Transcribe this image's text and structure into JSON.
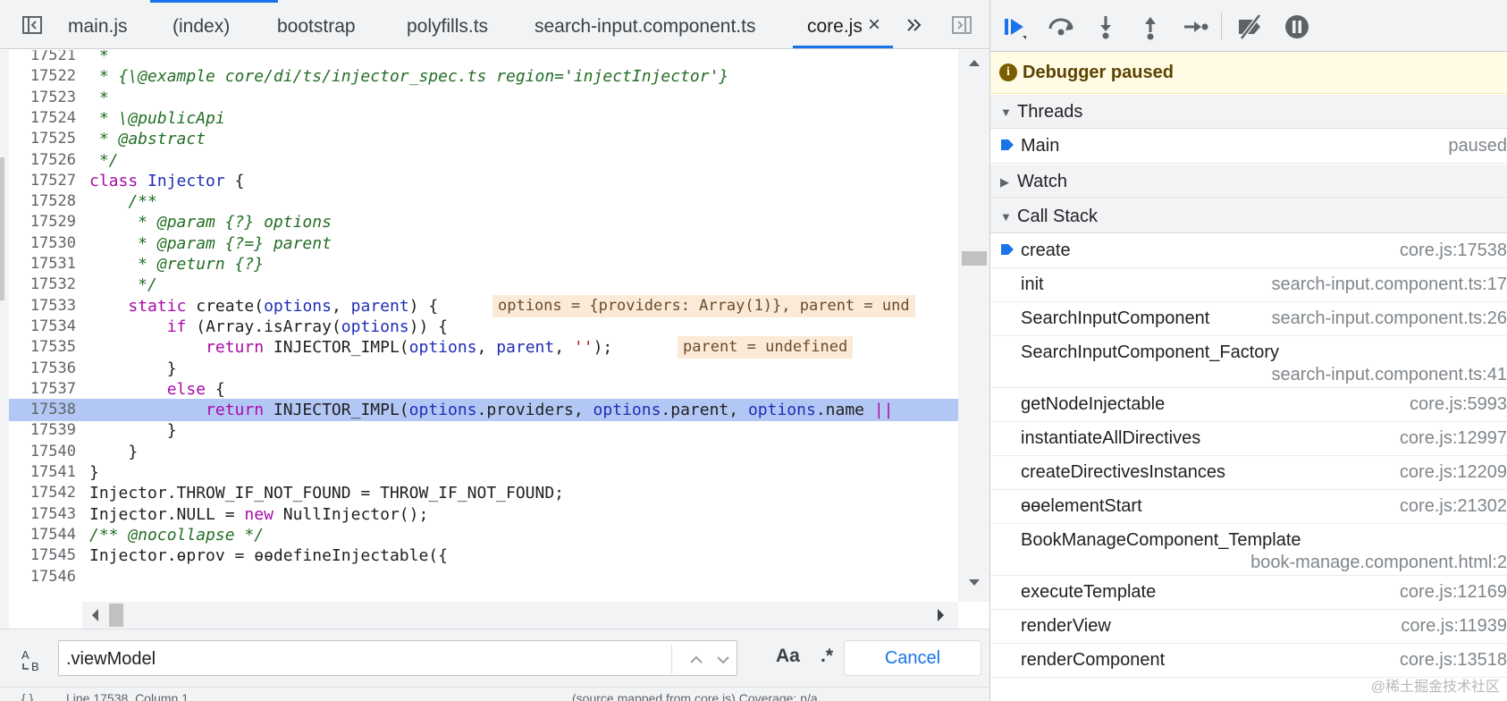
{
  "tabs": [
    {
      "label": "main.js"
    },
    {
      "label": "(index)"
    },
    {
      "label": "bootstrap"
    },
    {
      "label": "polyfills.ts"
    },
    {
      "label": "search-input.component.ts"
    },
    {
      "label": "core.js",
      "active": true
    }
  ],
  "code_lines": [
    {
      "n": "17521",
      "segments": [
        {
          "t": " *",
          "c": "c-cm"
        }
      ]
    },
    {
      "n": "17522",
      "segments": [
        {
          "t": " * {\\@example core/di/ts/injector_spec.ts region='injectInjector'}",
          "c": "c-cm"
        }
      ]
    },
    {
      "n": "17523",
      "segments": [
        {
          "t": " *",
          "c": "c-cm"
        }
      ]
    },
    {
      "n": "17524",
      "segments": [
        {
          "t": " * \\@publicApi",
          "c": "c-cm"
        }
      ]
    },
    {
      "n": "17525",
      "segments": [
        {
          "t": " * @abstract",
          "c": "c-cm"
        }
      ]
    },
    {
      "n": "17526",
      "segments": [
        {
          "t": " */",
          "c": "c-cm"
        }
      ]
    },
    {
      "n": "17527",
      "segments": [
        {
          "t": "class ",
          "c": "c-kw"
        },
        {
          "t": "Injector",
          "c": "c-id"
        },
        {
          "t": " {",
          "c": ""
        }
      ]
    },
    {
      "n": "17528",
      "segments": [
        {
          "t": "    /**",
          "c": "c-cm"
        }
      ]
    },
    {
      "n": "17529",
      "segments": [
        {
          "t": "     * @param {?} options",
          "c": "c-cm"
        }
      ]
    },
    {
      "n": "17530",
      "segments": [
        {
          "t": "     * @param {?=} parent",
          "c": "c-cm"
        }
      ]
    },
    {
      "n": "17531",
      "segments": [
        {
          "t": "     * @return {?}",
          "c": "c-cm"
        }
      ]
    },
    {
      "n": "17532",
      "segments": [
        {
          "t": "     */",
          "c": "c-cm"
        }
      ]
    },
    {
      "n": "17533",
      "segments": [
        {
          "t": "    ",
          "c": ""
        },
        {
          "t": "static",
          "c": "c-kw"
        },
        {
          "t": " create(",
          "c": ""
        },
        {
          "t": "options",
          "c": "c-id"
        },
        {
          "t": ", ",
          "c": ""
        },
        {
          "t": "parent",
          "c": "c-id"
        },
        {
          "t": ") {",
          "c": ""
        }
      ],
      "inline": "options = {providers: Array(1)}, parent = und"
    },
    {
      "n": "17534",
      "segments": [
        {
          "t": "        ",
          "c": ""
        },
        {
          "t": "if",
          "c": "c-kw"
        },
        {
          "t": " (Array.isArray(",
          "c": ""
        },
        {
          "t": "options",
          "c": "c-id"
        },
        {
          "t": ")) {",
          "c": ""
        }
      ]
    },
    {
      "n": "17535",
      "segments": [
        {
          "t": "            ",
          "c": ""
        },
        {
          "t": "return",
          "c": "c-kw"
        },
        {
          "t": " INJECTOR_IMPL(",
          "c": ""
        },
        {
          "t": "options",
          "c": "c-id"
        },
        {
          "t": ", ",
          "c": ""
        },
        {
          "t": "parent",
          "c": "c-id"
        },
        {
          "t": ", ",
          "c": ""
        },
        {
          "t": "''",
          "c": "c-str"
        },
        {
          "t": ");",
          "c": ""
        }
      ],
      "inline": "parent = undefined"
    },
    {
      "n": "17536",
      "segments": [
        {
          "t": "        }",
          "c": ""
        }
      ]
    },
    {
      "n": "17537",
      "segments": [
        {
          "t": "        ",
          "c": ""
        },
        {
          "t": "else",
          "c": "c-kw"
        },
        {
          "t": " {",
          "c": ""
        }
      ]
    },
    {
      "n": "17538",
      "segments": [
        {
          "t": "            ",
          "c": ""
        },
        {
          "t": "return",
          "c": "c-kw"
        },
        {
          "t": " INJECTOR_IMPL(",
          "c": ""
        },
        {
          "t": "options",
          "c": "c-id"
        },
        {
          "t": ".providers, ",
          "c": ""
        },
        {
          "t": "options",
          "c": "c-id"
        },
        {
          "t": ".parent, ",
          "c": ""
        },
        {
          "t": "options",
          "c": "c-id"
        },
        {
          "t": ".name ",
          "c": ""
        },
        {
          "t": "||",
          "c": "c-kw"
        }
      ],
      "highlight": true
    },
    {
      "n": "17539",
      "segments": [
        {
          "t": "        }",
          "c": ""
        }
      ]
    },
    {
      "n": "17540",
      "segments": [
        {
          "t": "    }",
          "c": ""
        }
      ]
    },
    {
      "n": "17541",
      "segments": [
        {
          "t": "}",
          "c": ""
        }
      ]
    },
    {
      "n": "17542",
      "segments": [
        {
          "t": "Injector.THROW_IF_NOT_FOUND = THROW_IF_NOT_FOUND;",
          "c": ""
        }
      ]
    },
    {
      "n": "17543",
      "segments": [
        {
          "t": "Injector.NULL = ",
          "c": ""
        },
        {
          "t": "new",
          "c": "c-kw"
        },
        {
          "t": " NullInjector();",
          "c": ""
        }
      ]
    },
    {
      "n": "17544",
      "segments": [
        {
          "t": "/** @nocollapse */",
          "c": "c-cm"
        }
      ]
    },
    {
      "n": "17545",
      "segments": [
        {
          "t": "Injector.ɵprov = ɵɵdefineInjectable({",
          "c": ""
        }
      ]
    },
    {
      "n": "17546",
      "segments": [
        {
          "t": "",
          "c": ""
        }
      ]
    }
  ],
  "search": {
    "value": ".viewModel",
    "case_label": "Aa",
    "regex_label": ".*",
    "cancel_label": "Cancel"
  },
  "status": {
    "left": "Line 17538, Column 1",
    "right": "(source mapped from core.js) Coverage: n/a"
  },
  "debugger": {
    "banner": "Debugger paused",
    "threads_label": "Threads",
    "thread": {
      "name": "Main",
      "status": "paused"
    },
    "watch_label": "Watch",
    "callstack_label": "Call Stack",
    "frames": [
      {
        "name": "create",
        "loc": "core.js:17538",
        "current": true
      },
      {
        "name": "init",
        "loc": "search-input.component.ts:17"
      },
      {
        "name": "SearchInputComponent",
        "loc": "search-input.component.ts:26"
      },
      {
        "name": "SearchInputComponent_Factory",
        "loc": "search-input.component.ts:41",
        "wrap": true
      },
      {
        "name": "getNodeInjectable",
        "loc": "core.js:5993"
      },
      {
        "name": "instantiateAllDirectives",
        "loc": "core.js:12997"
      },
      {
        "name": "createDirectivesInstances",
        "loc": "core.js:12209"
      },
      {
        "name": "ɵɵelementStart",
        "loc": "core.js:21302"
      },
      {
        "name": "BookManageComponent_Template",
        "loc": "book-manage.component.html:2",
        "wrap": true
      },
      {
        "name": "executeTemplate",
        "loc": "core.js:12169"
      },
      {
        "name": "renderView",
        "loc": "core.js:11939"
      },
      {
        "name": "renderComponent",
        "loc": "core.js:13518"
      }
    ]
  },
  "watermark": "@稀土掘金技术社区",
  "colors": {
    "accent": "#1a73e8",
    "highlight_line": "#b3c7f5",
    "paused_banner": "#fffbe5"
  }
}
